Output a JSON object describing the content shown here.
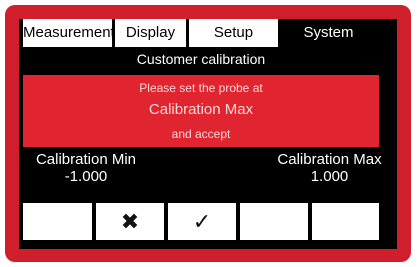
{
  "tabs": [
    {
      "label": "Measurement"
    },
    {
      "label": "Display"
    },
    {
      "label": "Setup"
    },
    {
      "label": "System"
    }
  ],
  "screen_title": "Customer calibration",
  "prompt": {
    "line1": "Please set the probe at",
    "line2": "Calibration Max",
    "line3": "and accept"
  },
  "calibration": {
    "min_label": "Calibration Min",
    "min_value": "-1.000",
    "max_label": "Calibration Max",
    "max_value": "1.000"
  },
  "softkeys": {
    "cancel_symbol": "✖",
    "accept_symbol": "✓"
  },
  "colors": {
    "frame": "#cf1f2d",
    "banner": "#e12530",
    "screen": "#000000"
  }
}
